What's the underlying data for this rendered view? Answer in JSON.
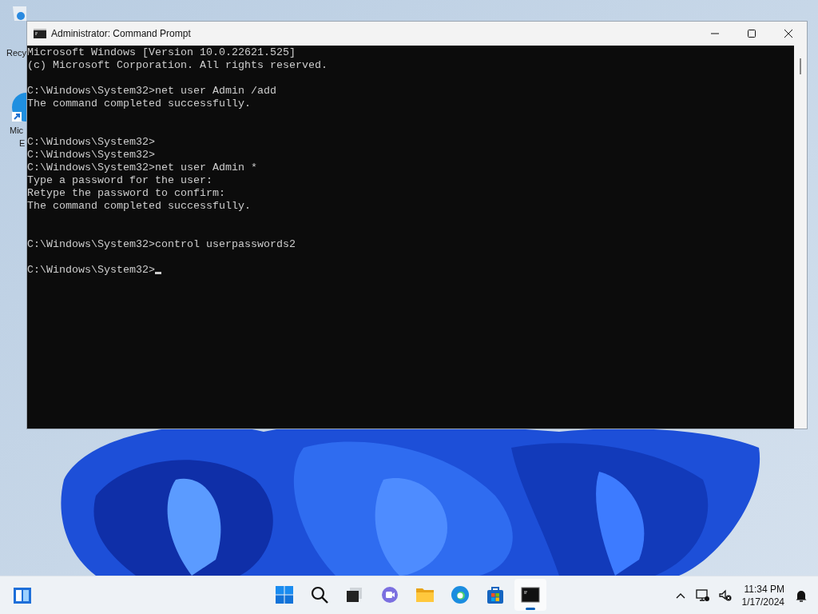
{
  "desktop": {
    "icons": [
      {
        "label_lines": [
          "Recy"
        ]
      },
      {
        "label_lines": [
          "Mic",
          "E"
        ]
      }
    ]
  },
  "window": {
    "title": "Administrator: Command Prompt",
    "console": [
      {
        "kind": "text",
        "text": "Microsoft Windows [Version 10.0.22621.525]"
      },
      {
        "kind": "text",
        "text": "(c) Microsoft Corporation. All rights reserved."
      },
      {
        "kind": "blank"
      },
      {
        "kind": "text",
        "text": "C:\\Windows\\System32>net user Admin /add"
      },
      {
        "kind": "text",
        "text": "The command completed successfully."
      },
      {
        "kind": "blank"
      },
      {
        "kind": "blank"
      },
      {
        "kind": "text",
        "text": "C:\\Windows\\System32>"
      },
      {
        "kind": "text",
        "text": "C:\\Windows\\System32>"
      },
      {
        "kind": "text",
        "text": "C:\\Windows\\System32>net user Admin *"
      },
      {
        "kind": "text",
        "text": "Type a password for the user:"
      },
      {
        "kind": "text",
        "text": "Retype the password to confirm:"
      },
      {
        "kind": "text",
        "text": "The command completed successfully."
      },
      {
        "kind": "blank"
      },
      {
        "kind": "blank"
      },
      {
        "kind": "text",
        "text": "C:\\Windows\\System32>control userpasswords2"
      },
      {
        "kind": "blank"
      },
      {
        "kind": "input",
        "text": "C:\\Windows\\System32>"
      }
    ]
  },
  "taskbar": {
    "apps": [
      {
        "kind": "start",
        "selected": false
      },
      {
        "kind": "search",
        "selected": false
      },
      {
        "kind": "taskview",
        "selected": false
      },
      {
        "kind": "chat",
        "selected": false
      },
      {
        "kind": "explorer",
        "selected": false
      },
      {
        "kind": "edge",
        "selected": false
      },
      {
        "kind": "store",
        "selected": false
      },
      {
        "kind": "terminal",
        "selected": true
      }
    ],
    "clock": {
      "time": "11:34 PM",
      "date": "1/17/2024"
    }
  }
}
